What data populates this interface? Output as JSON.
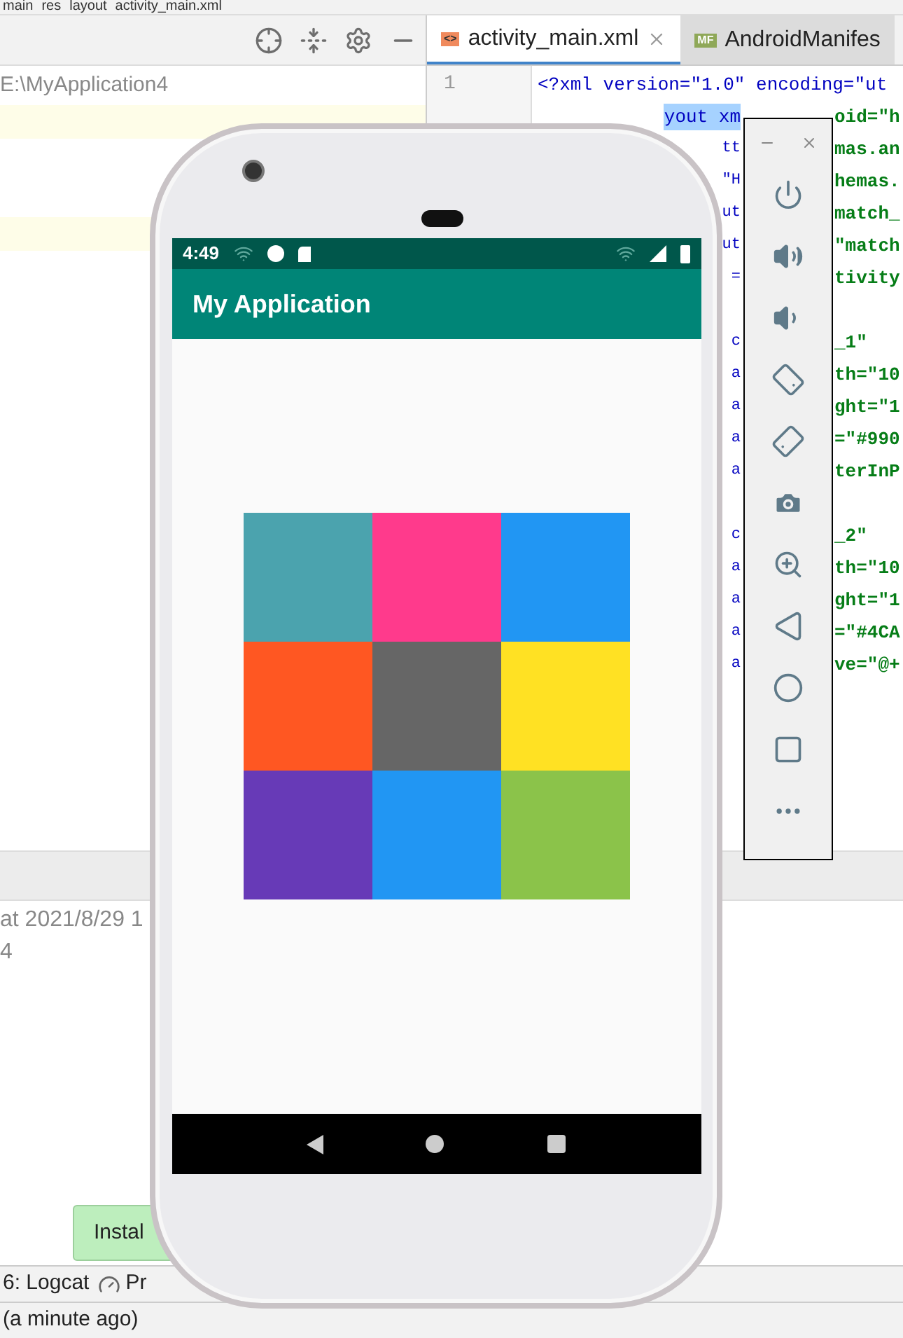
{
  "breadcrumb": [
    "main",
    "res",
    "layout",
    "activity_main.xml"
  ],
  "project_pane": {
    "path": "E:\\MyApplication4"
  },
  "editor_tabs": [
    {
      "label": "activity_main.xml",
      "selected": true,
      "closable": true,
      "badge": "<>"
    },
    {
      "label": "AndroidManifes",
      "selected": false,
      "closable": false,
      "badge": "MF"
    }
  ],
  "code": {
    "line_numbers": [
      "1"
    ],
    "lines": [
      {
        "kind": "full",
        "text": "<?xml version=\"1.0\" encoding=\"ut"
      },
      {
        "kind": "split",
        "left": "yout xm",
        "right": "oid=\"h",
        "highlight": true
      },
      {
        "kind": "split",
        "left": "tt",
        "right": "mas.an"
      },
      {
        "kind": "split",
        "left": "\"H",
        "right": "hemas."
      },
      {
        "kind": "split",
        "left": "ut",
        "right": "match_"
      },
      {
        "kind": "split",
        "left": "ut",
        "right": "\"match"
      },
      {
        "kind": "split",
        "left": "=",
        "right": "tivity"
      },
      {
        "kind": "blank"
      },
      {
        "kind": "split",
        "left": "c",
        "right": "_1\""
      },
      {
        "kind": "split",
        "left": "a",
        "right": "th=\"10"
      },
      {
        "kind": "split",
        "left": "a",
        "right": "ght=\"1"
      },
      {
        "kind": "split",
        "left": "a",
        "right": "=\"#990"
      },
      {
        "kind": "split",
        "left": "a",
        "right": "terInP"
      },
      {
        "kind": "blank"
      },
      {
        "kind": "split",
        "left": "c",
        "right": "_2\""
      },
      {
        "kind": "split",
        "left": "a",
        "right": "th=\"10"
      },
      {
        "kind": "split",
        "left": "a",
        "right": "ght=\"1"
      },
      {
        "kind": "split",
        "left": "a",
        "right": "=\"#4CA"
      },
      {
        "kind": "split",
        "left": "a",
        "right": "ve=\"@+"
      }
    ]
  },
  "log": {
    "lines": [
      "at 2021/8/29 1",
      "4"
    ]
  },
  "toast": {
    "text": "Instal"
  },
  "tool_windows": [
    {
      "label": "6: Logcat"
    },
    {
      "label": "Pr"
    }
  ],
  "status_bar": {
    "text": "(a minute ago)"
  },
  "emulator": {
    "status_time": "4:49",
    "app_title": "My Application",
    "tiles": [
      {
        "color": "#4ba3ae"
      },
      {
        "color": "#ff3a8c"
      },
      {
        "color": "#2196f3"
      },
      {
        "color": "#ff5722"
      },
      {
        "color": "#666666"
      },
      {
        "color": "#ffe123"
      },
      {
        "color": "#673ab7"
      },
      {
        "color": "#2196f3"
      },
      {
        "color": "#8bc34a"
      }
    ],
    "controls": [
      {
        "kind": "power"
      },
      {
        "kind": "volume_up"
      },
      {
        "kind": "volume_down"
      },
      {
        "kind": "rotate_left"
      },
      {
        "kind": "rotate_right"
      },
      {
        "kind": "screenshot"
      },
      {
        "kind": "zoom"
      },
      {
        "kind": "back"
      },
      {
        "kind": "home"
      },
      {
        "kind": "overview"
      },
      {
        "kind": "more"
      }
    ]
  }
}
